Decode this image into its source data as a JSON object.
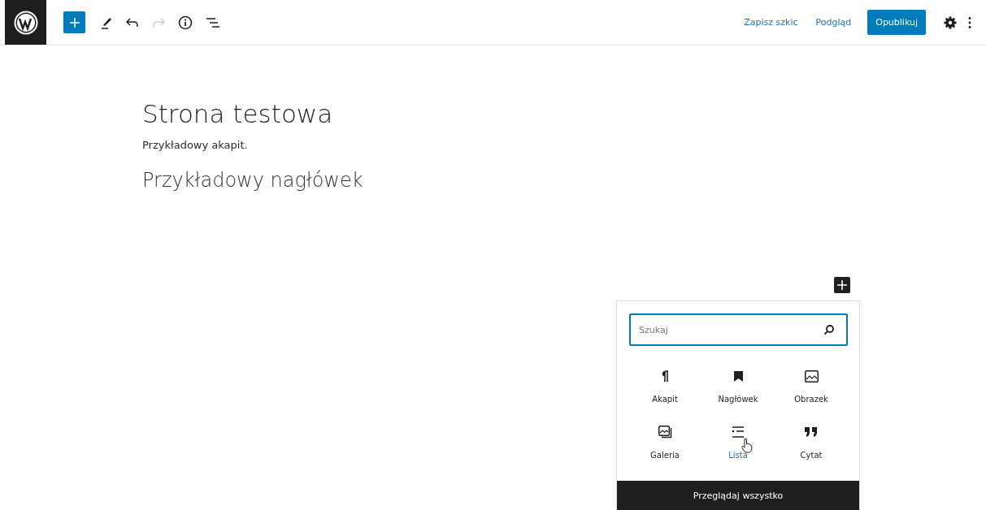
{
  "toolbar": {
    "tools": [
      {
        "kind": "add",
        "disabled": false
      },
      {
        "kind": "pen",
        "disabled": false
      },
      {
        "kind": "undo",
        "disabled": false
      },
      {
        "kind": "redo",
        "disabled": true
      },
      {
        "kind": "info",
        "disabled": false
      },
      {
        "kind": "outline",
        "disabled": false
      }
    ],
    "save_draft": "Zapisz szkic",
    "preview": "Podgląd",
    "publish": "Opublikuj"
  },
  "editor": {
    "title": "Strona testowa",
    "paragraph": "Przykładowy akapit.",
    "heading": "Przykładowy nagłówek"
  },
  "inserter": {
    "search": {
      "placeholder": "Szukaj"
    },
    "blocks": [
      {
        "kind": "paragraph",
        "label": "Akapit",
        "hovered": false
      },
      {
        "kind": "heading",
        "label": "Nagłówek",
        "hovered": false
      },
      {
        "kind": "image",
        "label": "Obrazek",
        "hovered": false
      },
      {
        "kind": "gallery",
        "label": "Galeria",
        "hovered": false
      },
      {
        "kind": "list",
        "label": "Lista",
        "hovered": true
      },
      {
        "kind": "quote",
        "label": "Cytat",
        "hovered": false
      }
    ],
    "browse_all": "Przeglądaj wszystko"
  }
}
